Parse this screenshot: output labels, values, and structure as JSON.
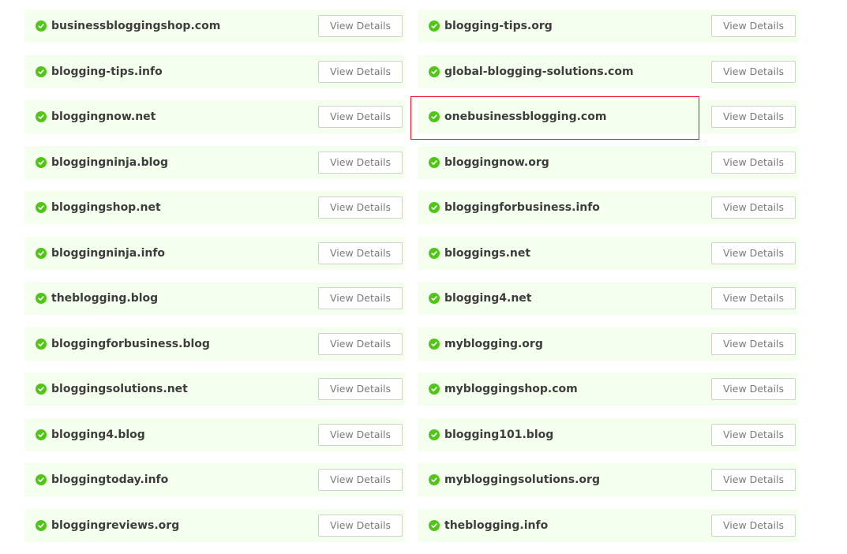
{
  "button_label": "View Details",
  "colors": {
    "card_bg": "#f5ffee",
    "check_green": "#52c41a",
    "highlight_red": "#e0141e"
  },
  "icons": {
    "status": "check-circle-icon"
  },
  "domains": [
    "businessbloggingshop.com",
    "blogging-tips.org",
    "blogging-tips.info",
    "global-blogging-solutions.com",
    "bloggingnow.net",
    "onebusinessblogging.com",
    "bloggingninja.blog",
    "bloggingnow.org",
    "bloggingshop.net",
    "bloggingforbusiness.info",
    "bloggingninja.info",
    "bloggings.net",
    "theblogging.blog",
    "blogging4.net",
    "bloggingforbusiness.blog",
    "myblogging.org",
    "bloggingsolutions.net",
    "mybloggingshop.com",
    "blogging4.blog",
    "blogging101.blog",
    "bloggingtoday.info",
    "mybloggingsolutions.org",
    "bloggingreviews.org",
    "theblogging.info"
  ]
}
